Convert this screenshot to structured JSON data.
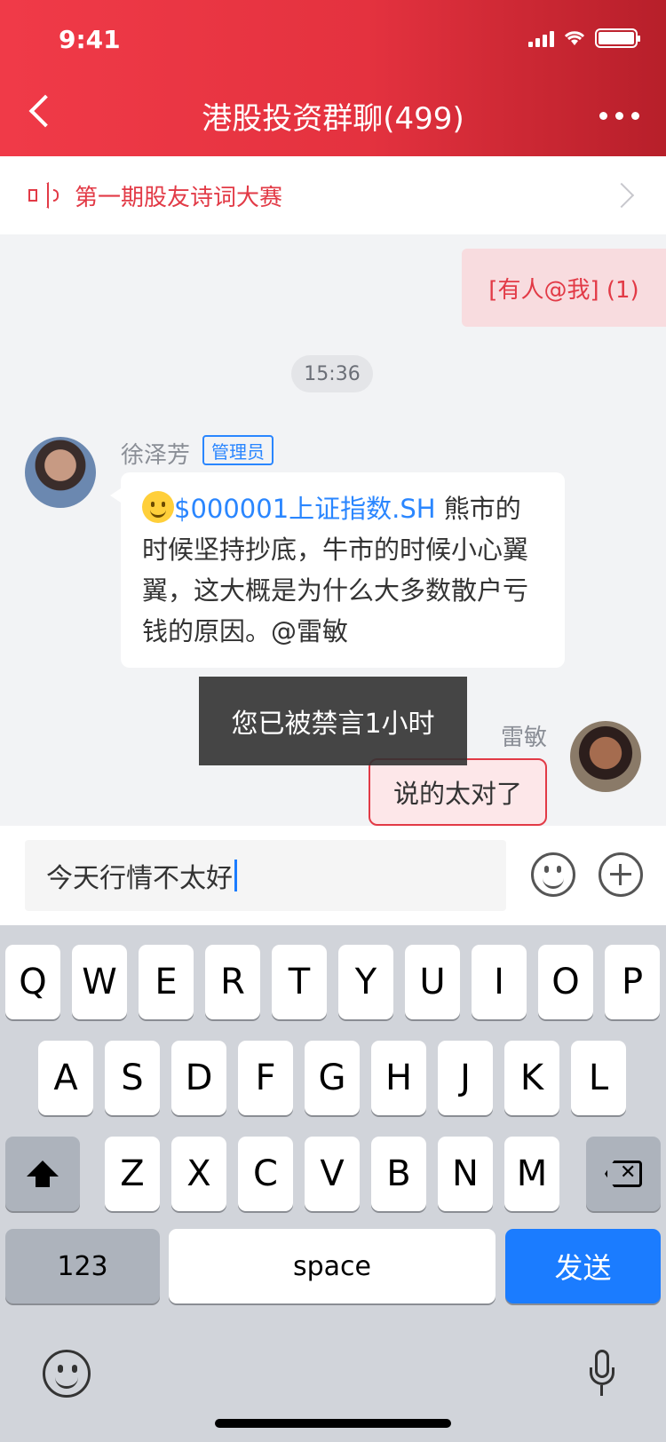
{
  "status_bar": {
    "time": "9:41"
  },
  "header": {
    "title": "港股投资群聊(499)"
  },
  "notice": {
    "text": "第一期股友诗词大赛"
  },
  "chat": {
    "mention_pill": "[有人@我] (1)",
    "time_divider": "15:36",
    "message1": {
      "sender": "徐泽芳",
      "badge": "管理员",
      "stock": "$000001上证指数.SH",
      "text": " 熊市的时候坚持抄底，牛市的时候小心翼翼，这大概是为什么大多数散户亏钱的原因。@雷敏"
    },
    "toast": "您已被禁言1小时",
    "message2": {
      "sender": "雷敏",
      "text": "说的太对了"
    }
  },
  "input": {
    "value": "今天行情不太好"
  },
  "keyboard": {
    "row1": [
      "Q",
      "W",
      "E",
      "R",
      "T",
      "Y",
      "U",
      "I",
      "O",
      "P"
    ],
    "row2": [
      "A",
      "S",
      "D",
      "F",
      "G",
      "H",
      "J",
      "K",
      "L"
    ],
    "row3": [
      "Z",
      "X",
      "C",
      "V",
      "B",
      "N",
      "M"
    ],
    "numbers_label": "123",
    "space_label": "space",
    "send_label": "发送"
  },
  "icons": [
    "back-icon",
    "more-icon",
    "speaker-icon",
    "chevron-right-icon",
    "smile-icon",
    "plus-icon",
    "shift-icon",
    "delete-icon",
    "emoji-icon",
    "mic-icon"
  ],
  "colors": {
    "accent_red": "#e23a46",
    "link_blue": "#2a86ff",
    "send_blue": "#1b7cff"
  }
}
